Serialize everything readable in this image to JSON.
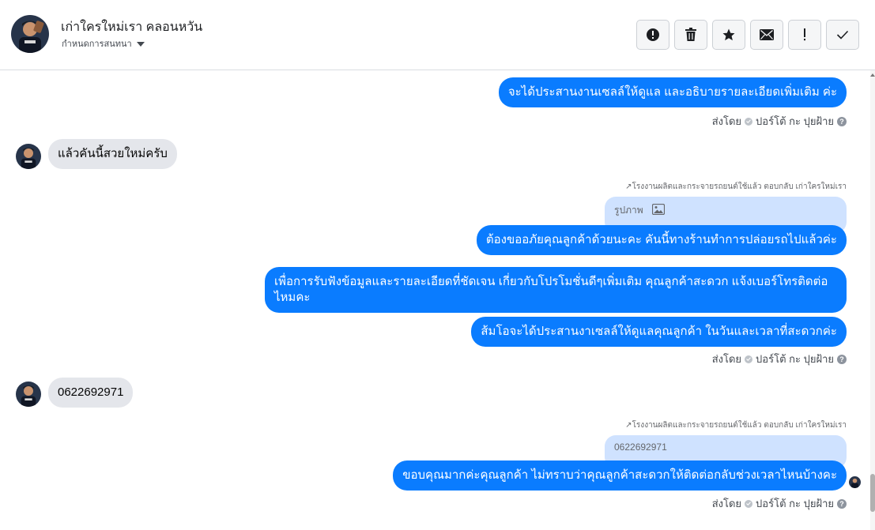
{
  "header": {
    "name": "เก่าใครใหม่เรา คลอนหวัน",
    "subtitle": "กำหนดการสนทนา",
    "actions": [
      {
        "label": "mark-spam",
        "icon": "exclamation-circle-icon"
      },
      {
        "label": "delete",
        "icon": "trash-icon"
      },
      {
        "label": "star",
        "icon": "star-icon"
      },
      {
        "label": "mark-unread",
        "icon": "envelope-icon"
      },
      {
        "label": "mark-important",
        "icon": "exclamation-icon"
      },
      {
        "label": "mark-done",
        "icon": "checkmark-icon"
      }
    ]
  },
  "messages": {
    "m1": "จะได้ประสานงานเซลล์ให้ดูแล และอธิบายรายละเอียดเพิ่มเติม ค่ะ",
    "sent1": "ส่งโดย",
    "sender1": "ปอร์โต้ กะ ปุยฝ้าย",
    "in1": "แล้วคันนี้สวยใหม่ครับ",
    "reply1": "โรงงานผลิตและกระจายรถยนต์ใช้แล้ว ตอบกลับ เก่าใครใหม่เรา",
    "quote1": "รูปภาพ",
    "m2": "ต้องขออภัยคุณลูกค้าด้วยนะคะ คันนี้ทางร้านทำการปล่อยรถไปแล้วค่ะ",
    "m3": "เพื่อการรับฟังข้อมูลและรายละเอียดที่ชัดเจน เกี่ยวกับโปรโมชั่นดีๆเพิ่มเติม คุณลูกค้าสะดวก แจ้งเบอร์โทรติดต่อไหมคะ",
    "m4": "ส้มโอจะได้ประสานงาเซลล์ให้ดูแลคุณลูกค้า ในวันและเวลาที่สะดวกค่ะ",
    "sent2": "ส่งโดย",
    "sender2": "ปอร์โต้ กะ ปุยฝ้าย",
    "in2": "0622692971",
    "reply2": "โรงงานผลิตและกระจายรถยนต์ใช้แล้ว ตอบกลับ เก่าใครใหม่เรา",
    "quote2": "0622692971",
    "m5": "ขอบคุณมากค่ะคุณลูกค้า ไม่ทราบว่าคุณลูกค้าสะดวกให้ติดต่อกลับช่วงเวลาไหนบ้างคะ",
    "sent3": "ส่งโดย",
    "sender3": "ปอร์โต้ กะ ปุยฝ้าย"
  },
  "colors": {
    "outgoing": "#0a7cff",
    "incoming": "#e4e6eb",
    "quote": "#cfe2ff"
  }
}
